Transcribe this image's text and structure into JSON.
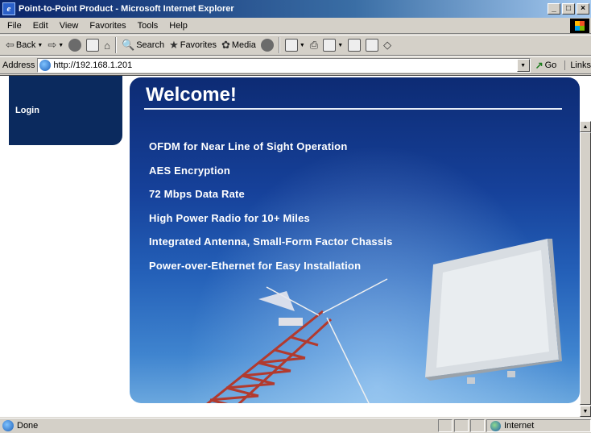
{
  "window": {
    "title": "Point-to-Point Product - Microsoft Internet Explorer"
  },
  "menubar": {
    "items": [
      "File",
      "Edit",
      "View",
      "Favorites",
      "Tools",
      "Help"
    ]
  },
  "toolbar": {
    "back_label": "Back",
    "search_label": "Search",
    "favorites_label": "Favorites",
    "media_label": "Media"
  },
  "addressbar": {
    "label": "Address",
    "url": "http://192.168.1.201",
    "go_label": "Go",
    "links_label": "Links"
  },
  "sidebar": {
    "login_label": "Login"
  },
  "hero": {
    "title": "Welcome!",
    "features": [
      "OFDM for Near Line of Sight Operation",
      "AES Encryption",
      "72 Mbps Data Rate",
      "High Power Radio for 10+ Miles",
      "Integrated Antenna, Small-Form Factor Chassis",
      "Power-over-Ethernet for Easy Installation"
    ]
  },
  "statusbar": {
    "text": "Done",
    "zone": "Internet"
  },
  "colors": {
    "titlebar": "#0a246a",
    "sidebar": "#0b2a5e",
    "hero_top": "#0d2b74",
    "hero_bottom": "#6aa7de"
  }
}
